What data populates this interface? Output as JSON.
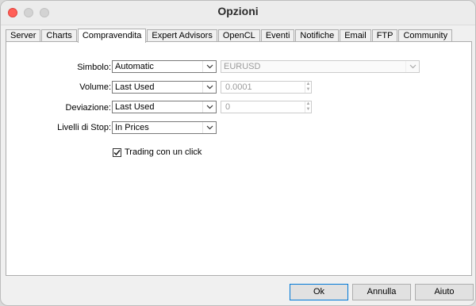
{
  "window": {
    "title": "Opzioni"
  },
  "tabs": [
    {
      "label": "Server"
    },
    {
      "label": "Charts"
    },
    {
      "label": "Compravendita",
      "active": true
    },
    {
      "label": "Expert Advisors"
    },
    {
      "label": "OpenCL"
    },
    {
      "label": "Eventi"
    },
    {
      "label": "Notifiche"
    },
    {
      "label": "Email"
    },
    {
      "label": "FTP"
    },
    {
      "label": "Community"
    }
  ],
  "form": {
    "symbol": {
      "label": "Simbolo:",
      "value": "Automatic",
      "secondary_value": "EURUSD"
    },
    "volume": {
      "label": "Volume:",
      "value": "Last Used",
      "spin_value": "0.0001"
    },
    "deviation": {
      "label": "Deviazione:",
      "value": "Last Used",
      "spin_value": "0"
    },
    "stop_levels": {
      "label": "Livelli di Stop:",
      "value": "In Prices"
    },
    "one_click": {
      "label": "Trading con un click",
      "checked": true
    }
  },
  "buttons": {
    "ok": "Ok",
    "cancel": "Annulla",
    "help": "Aiuto"
  },
  "icons": {
    "dropdown": "chevron-down-icon",
    "checkmark": "checkmark-icon",
    "spinner": "spin-arrows-icon"
  }
}
